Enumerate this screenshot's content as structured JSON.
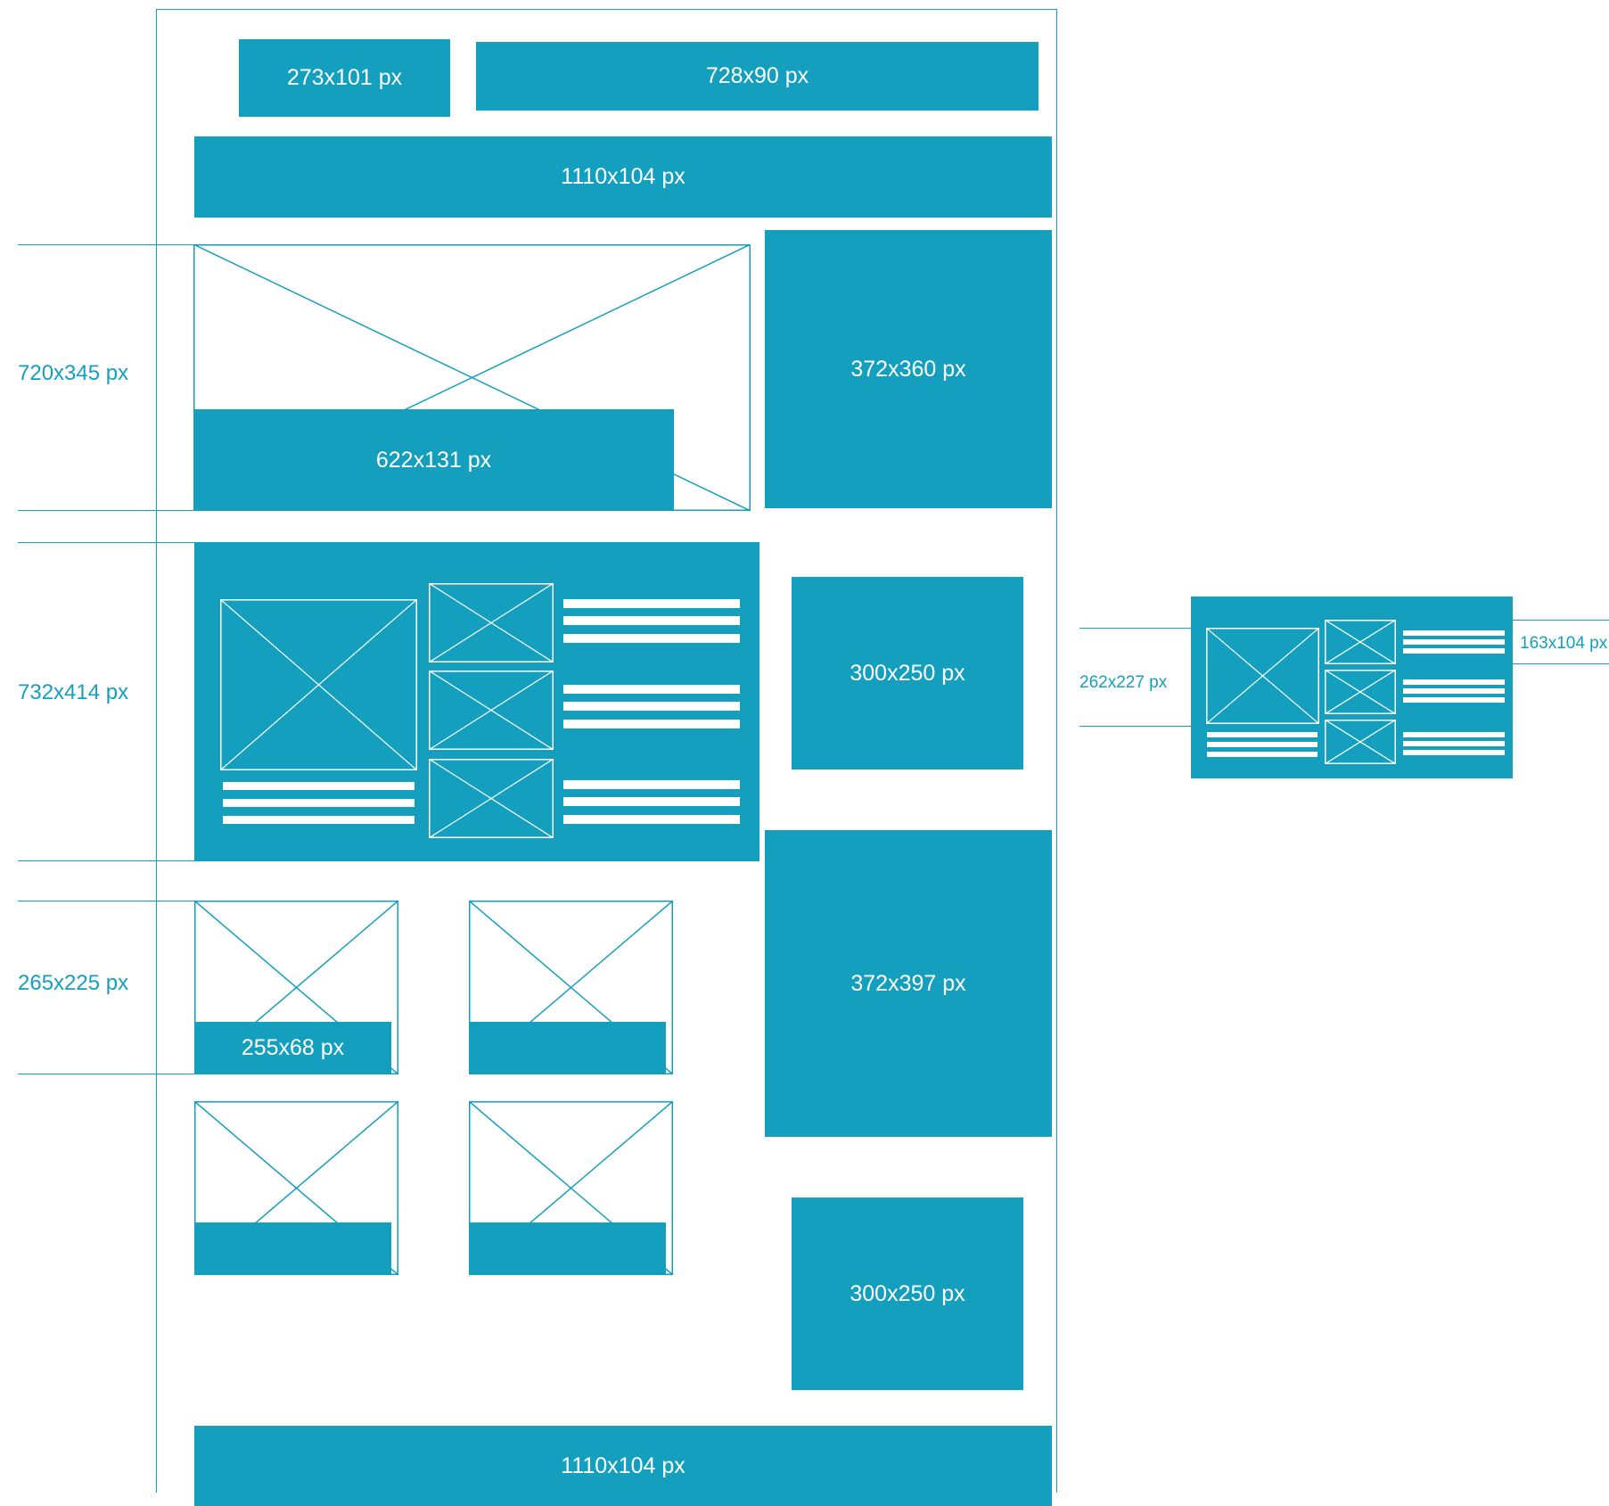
{
  "colors": {
    "accent": "#149fbf",
    "line": "#149fbf",
    "background": "#ffffff",
    "block_text": "#ffffff"
  },
  "blocks": {
    "logo": "273x101 px",
    "leaderboard": "728x90 px",
    "banner_top": "1110x104 px",
    "hero_caption": "622x131 px",
    "sidebar_1": "372x360 px",
    "sidebar_2": "300x250 px",
    "sidebar_3": "372x397 px",
    "sidebar_4": "300x250 px",
    "card_caption": "255x68 px",
    "banner_bottom": "1110x104 px"
  },
  "dimensions": {
    "hero": "720x345 px",
    "news_module": "732x414 px",
    "card": "265x225 px",
    "mini_module": "262x227 px",
    "mini_module_side": "163x104 px"
  },
  "icons": [
    "placeholder-image-icon"
  ]
}
